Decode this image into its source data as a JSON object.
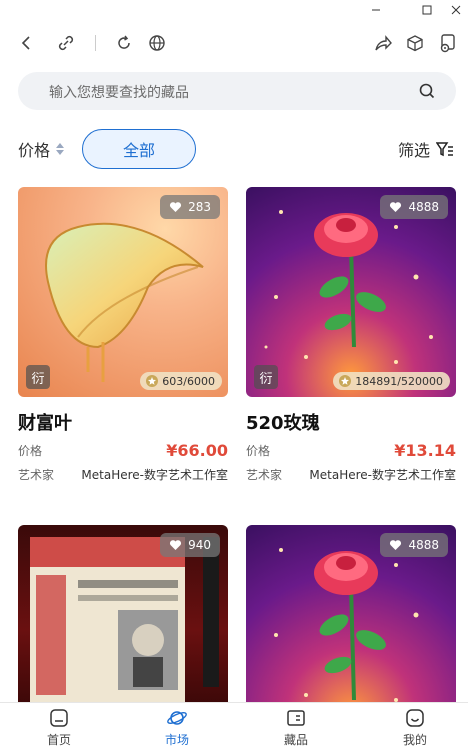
{
  "search": {
    "placeholder": "输入您想要查找的藏品"
  },
  "filters": {
    "price_label": "价格",
    "all_label": "全部",
    "filter_label": "筛选"
  },
  "items": [
    {
      "name": "财富叶",
      "likes": "283",
      "tag": "衍",
      "edition": "603/6000",
      "price_label": "价格",
      "price": "¥66.00",
      "artist_label": "艺术家",
      "artist": "MetaHere-数字艺术工作室"
    },
    {
      "name": "520玫瑰",
      "likes": "4888",
      "tag": "衍",
      "edition": "184891/520000",
      "price_label": "价格",
      "price": "¥13.14",
      "artist_label": "艺术家",
      "artist": "MetaHere-数字艺术工作室"
    },
    {
      "likes": "940"
    },
    {
      "likes": "4888"
    }
  ],
  "tabs": [
    {
      "label": "首页",
      "icon": "home-icon"
    },
    {
      "label": "市场",
      "icon": "planet-icon",
      "active": true
    },
    {
      "label": "藏品",
      "icon": "collection-icon"
    },
    {
      "label": "我的",
      "icon": "profile-icon"
    }
  ],
  "colors": {
    "accent": "#1f6fd1",
    "price": "#e04a3a"
  }
}
